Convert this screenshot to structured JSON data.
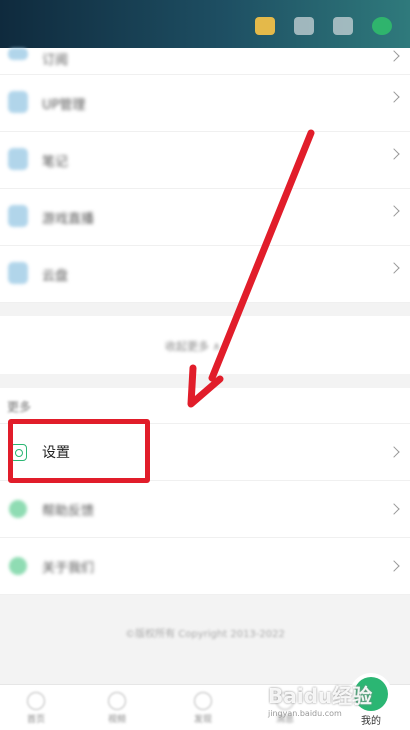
{
  "colors": {
    "accent": "#2bb673",
    "annotation": "#e11d2a"
  },
  "top_bar": {
    "icons": [
      "notification-icon",
      "message-icon",
      "scan-icon",
      "profile-icon"
    ]
  },
  "menu": {
    "items": [
      {
        "icon": "item-icon",
        "label": "订阅"
      },
      {
        "icon": "app-icon",
        "label": "UP管理"
      },
      {
        "icon": "note-icon",
        "label": "笔记"
      },
      {
        "icon": "cloud-icon",
        "label": "游戏直播"
      },
      {
        "icon": "cloud-icon",
        "label": "云盘"
      }
    ],
    "expand_label": "收起更多 ∧"
  },
  "section": {
    "title": "更多",
    "settings_label": "设置",
    "help_label": "帮助反馈",
    "about_label": "关于我们"
  },
  "footer": {
    "text": "©版权所有 Copyright 2013-2022"
  },
  "tabs": [
    {
      "label": "首页"
    },
    {
      "label": "视频"
    },
    {
      "label": "发现"
    },
    {
      "label": "消息"
    },
    {
      "label": "我的"
    }
  ],
  "watermark": {
    "text": "Baidu经验",
    "sub": "jingyan.baidu.com"
  }
}
